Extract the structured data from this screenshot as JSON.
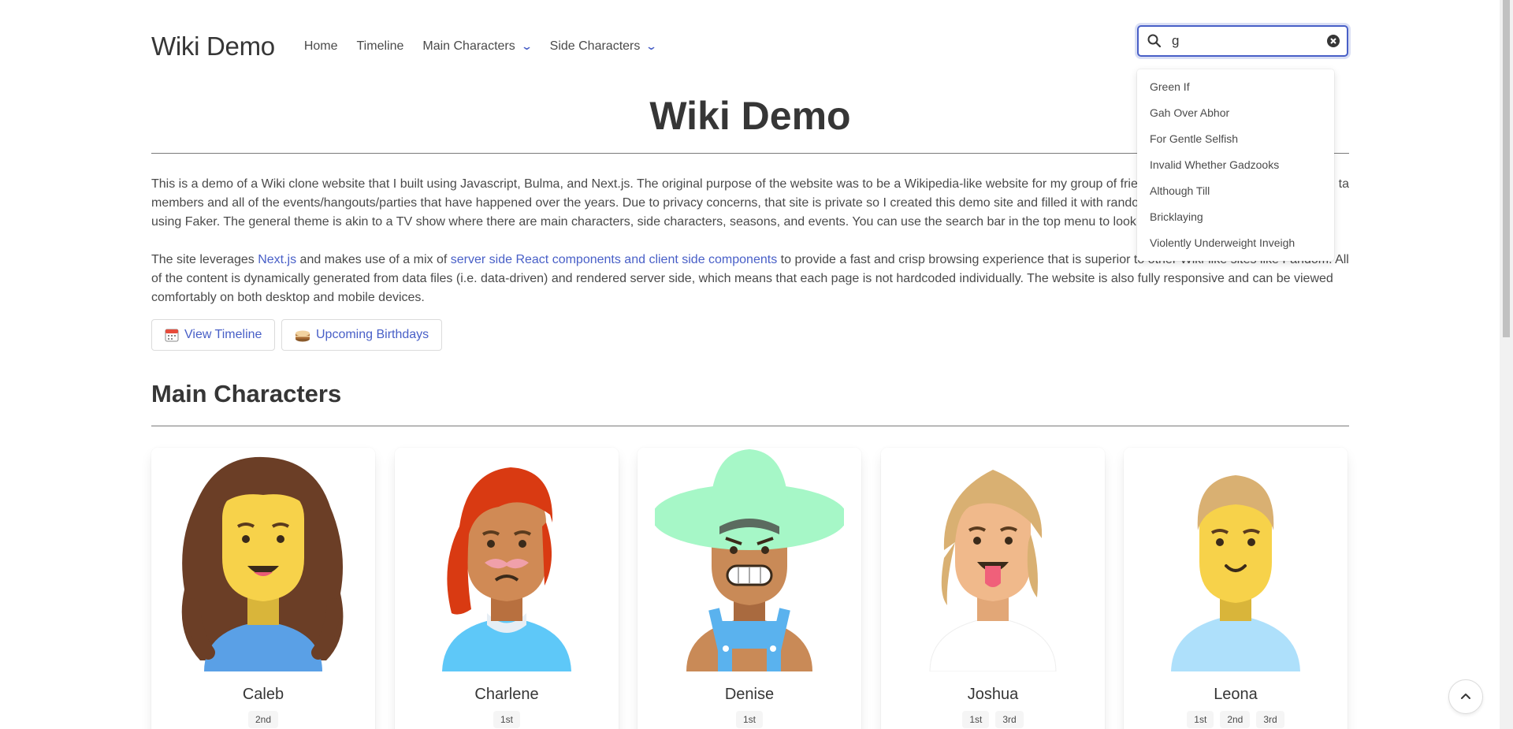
{
  "navbar": {
    "brand": "Wiki Demo",
    "items": [
      {
        "label": "Home"
      },
      {
        "label": "Timeline"
      },
      {
        "label": "Main Characters",
        "has_dropdown": true
      },
      {
        "label": "Side Characters",
        "has_dropdown": true
      }
    ]
  },
  "search": {
    "value": "g",
    "icon": "search-icon",
    "clear_icon": "clear-icon",
    "suggestions": [
      "Green If",
      "Gah Over Abhor",
      "For Gentle Selfish",
      "Invalid Whether Gadzooks",
      "Although Till",
      "Bricklaying",
      "Violently Underweight Inveigh"
    ]
  },
  "main": {
    "title": "Wiki Demo",
    "intro": {
      "line1": "This is a demo of a Wiki clone website that I built using Javascript, Bulma, and Next.js. The original purpose of the website was to be a Wikipedia-like website for my group of frien",
      "line1_right": "ta",
      "line2": "members and all of the events/hangouts/parties that have happened over the years. Due to privacy concerns, that site is private so I created this demo site and filled it with rando",
      "line3": "using Faker. The general theme is akin to a TV show where there are main characters, side characters, seasons, and events. You can use the search bar in the top menu to look for"
    },
    "tech": {
      "prefix": "The site leverages ",
      "link1": "Next.js",
      "middle": " and makes use of a mix of ",
      "link2": "server side React components and client side components",
      "suffix": " to provide a fast and crisp browsing experience that is superior to other Wiki-like sites like Fandom. All",
      "line2": "of the content is dynamically generated from data files (i.e. data-driven) and rendered server side, which means that each page is not hardcoded individually. The website is also fully responsive and can be viewed",
      "line3": "comfortably on both desktop and mobile devices."
    },
    "buttons": {
      "timeline": "View Timeline",
      "birthdays": "Upcoming Birthdays"
    },
    "section_title": "Main Characters",
    "characters": [
      {
        "name": "Caleb",
        "seasons": [
          "2nd"
        ]
      },
      {
        "name": "Charlene",
        "seasons": [
          "1st"
        ]
      },
      {
        "name": "Denise",
        "seasons": [
          "1st"
        ]
      },
      {
        "name": "Joshua",
        "seasons": [
          "1st",
          "3rd"
        ]
      },
      {
        "name": "Leona",
        "seasons": [
          "1st",
          "2nd",
          "3rd"
        ]
      }
    ]
  },
  "colors": {
    "link": "#485fc7",
    "text": "#4a4a4a",
    "heading": "#363636"
  }
}
